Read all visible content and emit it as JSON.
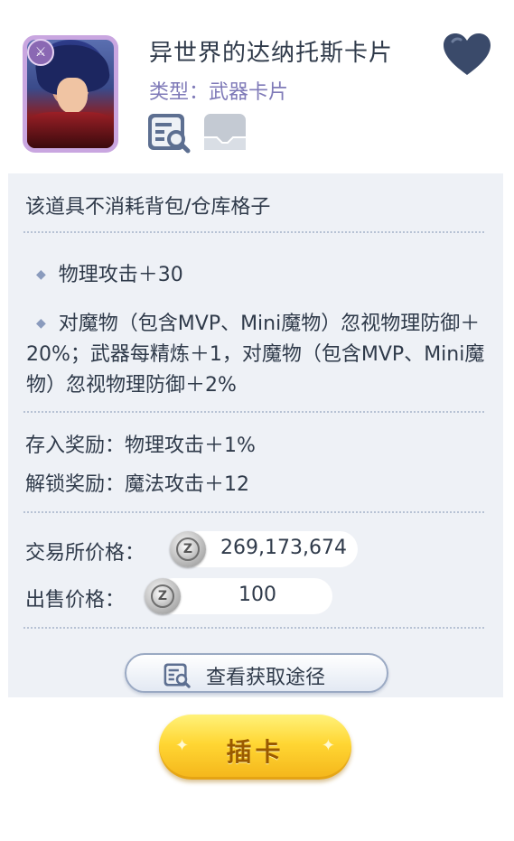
{
  "item": {
    "name": "异世界的达纳托斯卡片",
    "type_line": "类型：武器卡片",
    "icons": [
      "sword-icon",
      "heart-icon",
      "detail-magnifier-icon",
      "map-icon"
    ]
  },
  "panel": {
    "note": "该道具不消耗背包/仓库格子",
    "effects": [
      "物理攻击＋30",
      "对魔物（包含MVP、Mini魔物）忽视物理防御＋20%；武器每精炼＋1，对魔物（包含MVP、Mini魔物）忽视物理防御＋2%"
    ],
    "deposit_reward": "存入奖励：物理攻击＋1%",
    "unlock_reward": "解锁奖励：魔法攻击＋12",
    "exchange_price_label": "交易所价格：",
    "exchange_price_value": "269,173,674",
    "sell_price_label": "出售价格：",
    "sell_price_value": "100",
    "currency_icon_letter": "Z"
  },
  "buttons": {
    "view_source": "查看获取途径",
    "insert_card": "插卡"
  },
  "colors": {
    "panel_bg": "#eef1f6",
    "type_text": "#7f7ab8",
    "heart": "#3a4a6a",
    "insert_button": "#ffd633"
  }
}
